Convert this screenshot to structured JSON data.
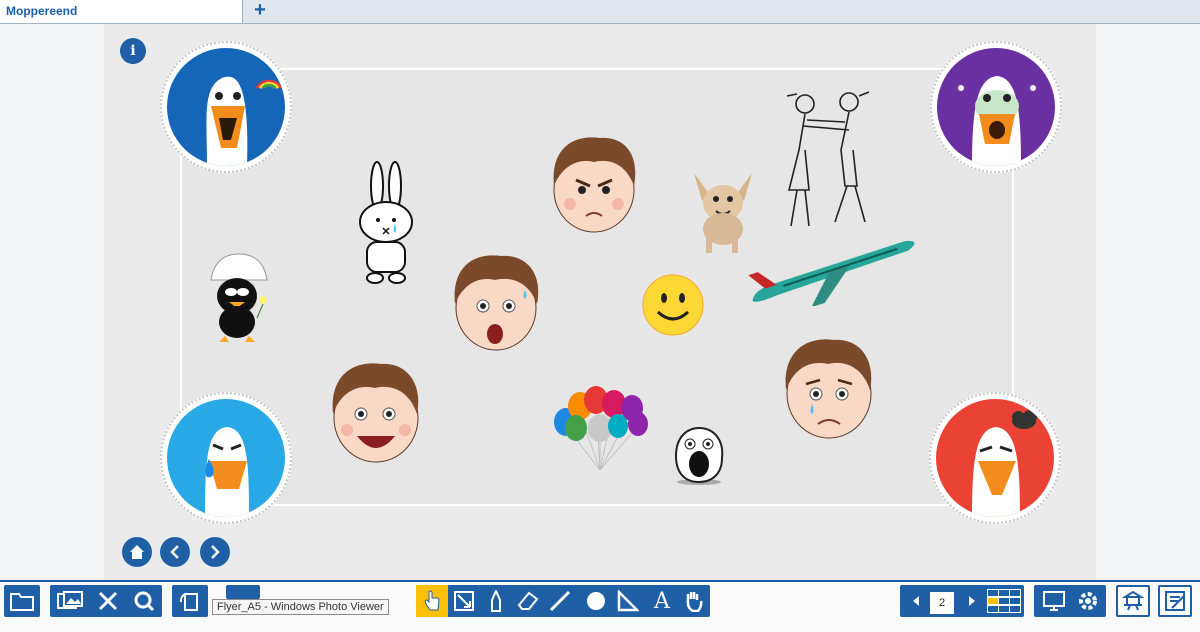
{
  "tabs": [
    {
      "label": "Moppereend"
    }
  ],
  "new_tab_icon": "plus-icon",
  "board": {
    "info_icon": "info-icon",
    "nav": {
      "home_icon": "home-icon",
      "prev_icon": "chevron-left-icon",
      "next_icon": "chevron-right-icon"
    },
    "corner_geese": [
      "happy-goose-rainbow",
      "scared-goose-purple",
      "crying-goose-blue",
      "grumpy-goose-red"
    ],
    "stickers": [
      "miffy-crying",
      "boy-face-angry",
      "chihuahua-dog",
      "fighting-couple-sketch",
      "calimero-chick",
      "boy-face-scared",
      "smiley-face",
      "airplane",
      "boy-face-laughing",
      "balloons",
      "shocked-ghost",
      "boy-face-sad"
    ]
  },
  "toolbar": {
    "icons_left": [
      "folder-icon",
      "photos-icon",
      "tools-icon",
      "zoom-icon",
      "rotate-page-icon",
      "undo-icon"
    ],
    "tooltip": "Flyer_A5 - Windows Photo Viewer",
    "drawing_tools": [
      "pointer-hand-icon",
      "select-resize-icon",
      "pen-icon",
      "eraser-icon",
      "line-icon",
      "circle-icon",
      "ruler-triangle-icon",
      "text-icon",
      "pan-hand-icon"
    ],
    "page_number": "2",
    "page_icons": [
      "page-prev-icon",
      "page-next-icon",
      "grid-view-icon"
    ],
    "icons_right": [
      "fullscreen-icon",
      "settings-icon",
      "presenter-icon",
      "edit-icon"
    ]
  },
  "colors": {
    "accent": "#1e5fa6",
    "highlight": "#ffc107"
  }
}
